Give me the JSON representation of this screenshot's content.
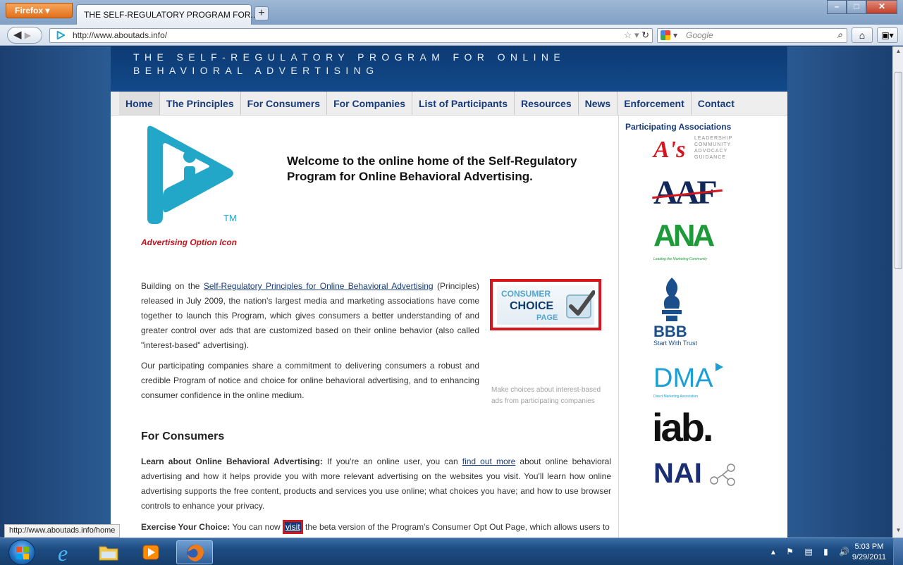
{
  "browser": {
    "menu_label": "Firefox",
    "tab_title": "THE SELF-REGULATORY PROGRAM FOR...",
    "newtab_label": "+",
    "url": "http://www.aboutads.info/",
    "search_placeholder": "Google",
    "status_url": "http://www.aboutads.info/home"
  },
  "site": {
    "title": "THE SELF-REGULATORY PROGRAM FOR ONLINE BEHAVIORAL ADVERTISING",
    "nav": [
      "Home",
      "The Principles",
      "For Consumers",
      "For Companies",
      "List of Participants",
      "Resources",
      "News",
      "Enforcement",
      "Contact"
    ],
    "logo_tm": "TM",
    "icon_caption": "Advertising Option Icon",
    "welcome": "Welcome to the online home of the Self-Regulatory Program for Online Behavioral Advertising.",
    "para1": {
      "pre": "Building on the ",
      "link": "Self-Regulatory Principles for Online Behavioral Advertising",
      "post": " (Principles) released in July 2009, the nation's largest media and marketing associations have come together to launch this Program, which gives consumers a better understanding of and greater control over ads that are customized based on their online behavior (also called \"interest-based\" advertising)."
    },
    "para2": "Our participating companies share a commitment to delivering consumers a robust and credible Program of notice and choice for online behavioral advertising, and to enhancing consumer confidence in the online medium.",
    "ccp": {
      "line1": "CONSUMER",
      "line2": "CHOICE",
      "line3": "PAGE",
      "caption": "Make choices about interest-based ads from participating companies"
    },
    "consumers_heading": "For Consumers",
    "para3": {
      "bold": "Learn about Online Behavioral Advertising:",
      "pre": " If you're an online user, you can ",
      "link": "find out more",
      "post": " about online behavioral advertising and how it helps provide you with more relevant advertising on the websites you visit. You'll learn how online advertising supports the free content, products and services you use online; what choices you have; and how to use browser controls to enhance your privacy."
    },
    "para4": {
      "bold": "Exercise Your Choice:",
      "pre": " You can now ",
      "link": "visit",
      "post": " the beta version of the Program's Consumer Opt Out Page, which allows users to"
    },
    "assoc_heading": "Participating Associations",
    "assoc": {
      "aaaa": "A's",
      "aaaa_tag": [
        "LEADERSHIP",
        "COMMUNITY",
        "ADVOCACY",
        "GUIDANCE"
      ],
      "aaf": "AAF",
      "ana": "ANA",
      "ana_tag": "Leading the Marketing Community",
      "bbb": "BBB",
      "bbb_tag": "Start With Trust",
      "dma": "DMA",
      "dma_tag": "Direct Marketing Association",
      "iab": "iab.",
      "nai": "NAI"
    }
  },
  "taskbar": {
    "time": "5:03 PM",
    "date": "9/29/2011"
  },
  "colors": {
    "nav_text": "#173b7a",
    "highlight_red": "#d8141d",
    "icon_cyan": "#22a7c9"
  }
}
